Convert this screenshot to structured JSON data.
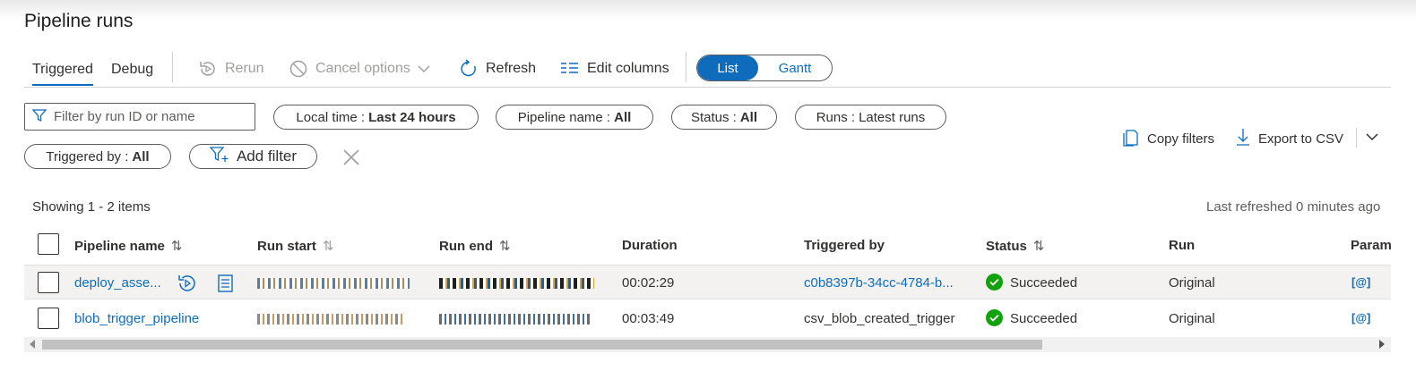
{
  "page": {
    "title": "Pipeline runs"
  },
  "tabs": [
    {
      "label": "Triggered",
      "active": true
    },
    {
      "label": "Debug",
      "active": false
    }
  ],
  "toolbar": {
    "rerun": "Rerun",
    "cancel_options": "Cancel options",
    "refresh": "Refresh",
    "edit_columns": "Edit columns",
    "view_list": "List",
    "view_gantt": "Gantt"
  },
  "filters": {
    "search_placeholder": "Filter by run ID or name",
    "local_time": {
      "label": "Local time :",
      "value": "Last 24 hours"
    },
    "pipeline_name": {
      "label": "Pipeline name :",
      "value": "All"
    },
    "status": {
      "label": "Status :",
      "value": "All"
    },
    "runs": {
      "label": "Runs :",
      "value": "Latest runs"
    },
    "triggered_by": {
      "label": "Triggered by :",
      "value": "All"
    },
    "add_filter": "Add filter"
  },
  "actions": {
    "copy_filters": "Copy filters",
    "export_csv": "Export to CSV"
  },
  "summary": {
    "showing": "Showing 1 - 2 items",
    "last_refreshed": "Last refreshed 0 minutes ago"
  },
  "table": {
    "columns": {
      "pipeline_name": "Pipeline name",
      "run_start": "Run start",
      "run_end": "Run end",
      "duration": "Duration",
      "triggered_by": "Triggered by",
      "status": "Status",
      "run": "Run",
      "parameters": "Param"
    },
    "rows": [
      {
        "pipeline_name": "deploy_asse...",
        "duration": "00:02:29",
        "triggered_by": "c0b8397b-34cc-4784-b...",
        "status": "Succeeded",
        "run": "Original",
        "param": "[@]"
      },
      {
        "pipeline_name": "blob_trigger_pipeline",
        "duration": "00:03:49",
        "triggered_by": "csv_blob_created_trigger",
        "status": "Succeeded",
        "run": "Original",
        "param": "[@]"
      }
    ]
  },
  "colors": {
    "accent": "#0f6cbd",
    "success": "#13a10e"
  }
}
